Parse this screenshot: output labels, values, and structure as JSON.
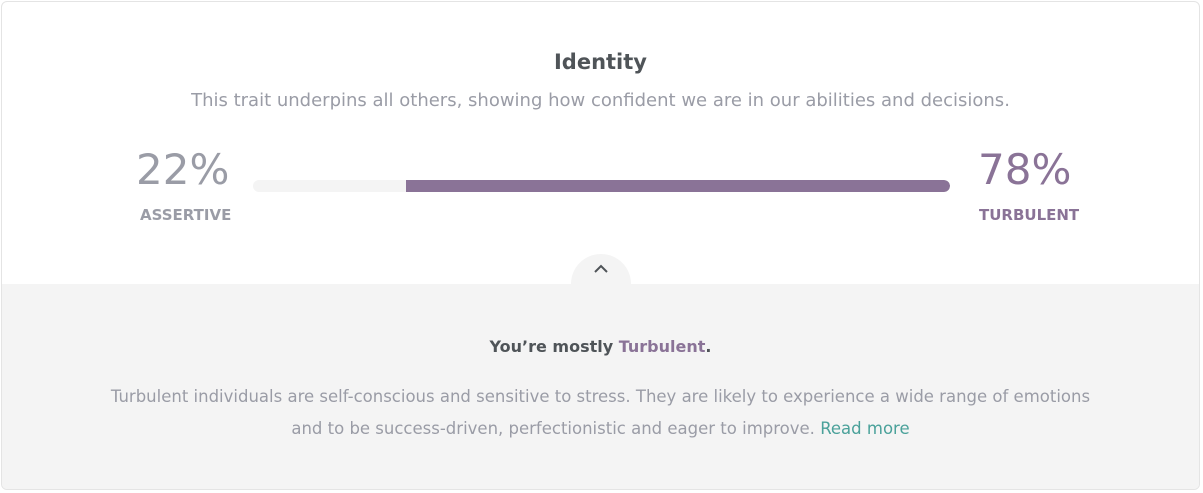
{
  "trait": {
    "title": "Identity",
    "subtitle": "This trait underpins all others, showing how confident we are in our abilities and decisions.",
    "left": {
      "percent": "22%",
      "label": "ASSERTIVE"
    },
    "right": {
      "percent": "78%",
      "label": "TURBULENT"
    },
    "dominant_fraction": 0.78,
    "colors": {
      "accent": "#8a7397",
      "track": "#f4f4f4",
      "link": "#4aa19a"
    }
  },
  "summary": {
    "prefix": "You’re mostly ",
    "trait": "Turbulent",
    "suffix": ".",
    "description_line1": "Turbulent individuals are self-conscious and sensitive to stress. They are likely to experience a wide range of emotions",
    "description_line2": "and to be success-driven, perfectionistic and eager to improve. ",
    "read_more": "Read more",
    "collapse_icon": "chevron-up-icon"
  }
}
